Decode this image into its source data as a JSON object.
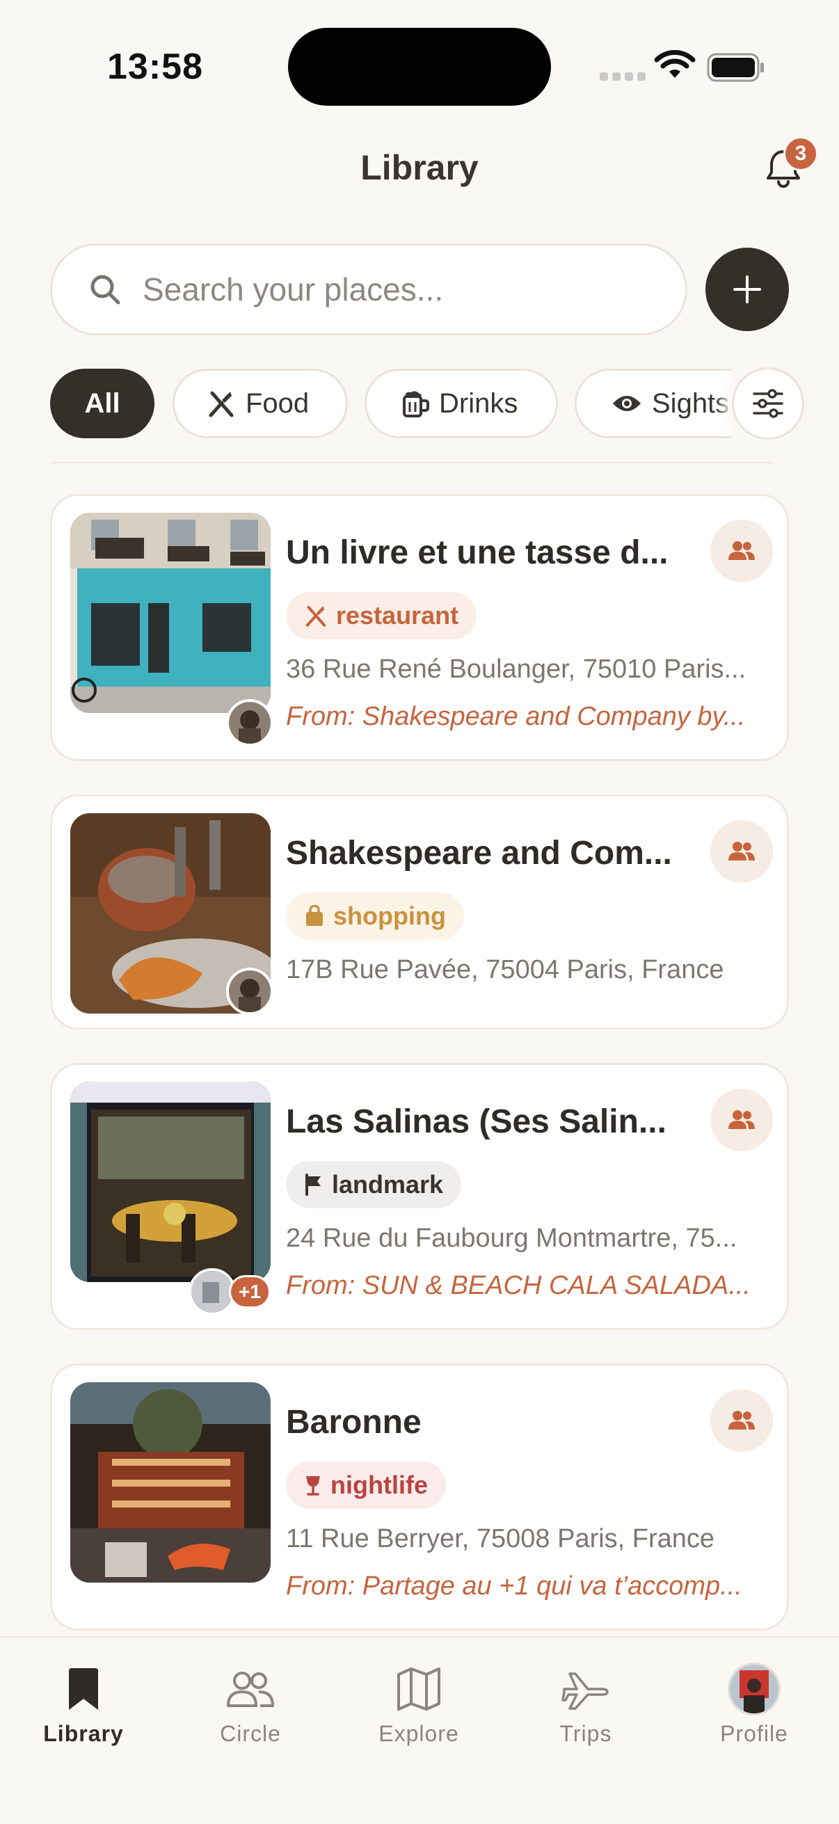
{
  "status_bar": {
    "time": "13:58"
  },
  "header": {
    "title": "Library",
    "notification_count": "3"
  },
  "search": {
    "placeholder": "Search your places..."
  },
  "filters": [
    {
      "label": "All",
      "icon": "none",
      "active": true
    },
    {
      "label": "Food",
      "icon": "fork-knife-icon"
    },
    {
      "label": "Drinks",
      "icon": "beer-mug-icon"
    },
    {
      "label": "Sights",
      "icon": "eye-icon"
    }
  ],
  "places": [
    {
      "title": "Un livre et une tasse d...",
      "tag": "restaurant",
      "tag_icon": "fork-knife-icon",
      "address": "36 Rue René Boulanger, 75010 Paris...",
      "from": "From: Shakespeare and Company by..."
    },
    {
      "title": "Shakespeare and Com...",
      "tag": "shopping",
      "tag_icon": "shopping-bag-icon",
      "address": "17B Rue Pavée, 75004 Paris, France",
      "from": ""
    },
    {
      "title": "Las Salinas (Ses Salin...",
      "tag": "landmark",
      "tag_icon": "flag-icon",
      "address": "24 Rue du Faubourg Montmartre, 75...",
      "from": "From: SUN & BEACH CALA SALADA...",
      "extra_contributors": "+1"
    },
    {
      "title": "Baronne",
      "tag": "nightlife",
      "tag_icon": "wine-glass-icon",
      "address": "11 Rue Berryer, 75008 Paris, France",
      "from": "From: Partage au +1 qui va t’accomp..."
    }
  ],
  "tabs": [
    {
      "label": "Library",
      "icon": "bookmark-icon",
      "active": true
    },
    {
      "label": "Circle",
      "icon": "people-icon"
    },
    {
      "label": "Explore",
      "icon": "map-icon"
    },
    {
      "label": "Trips",
      "icon": "airplane-icon"
    },
    {
      "label": "Profile",
      "icon": "avatar"
    }
  ],
  "colors": {
    "accent": "#c7643e",
    "dark": "#352f2a",
    "background": "#faf8f5"
  }
}
